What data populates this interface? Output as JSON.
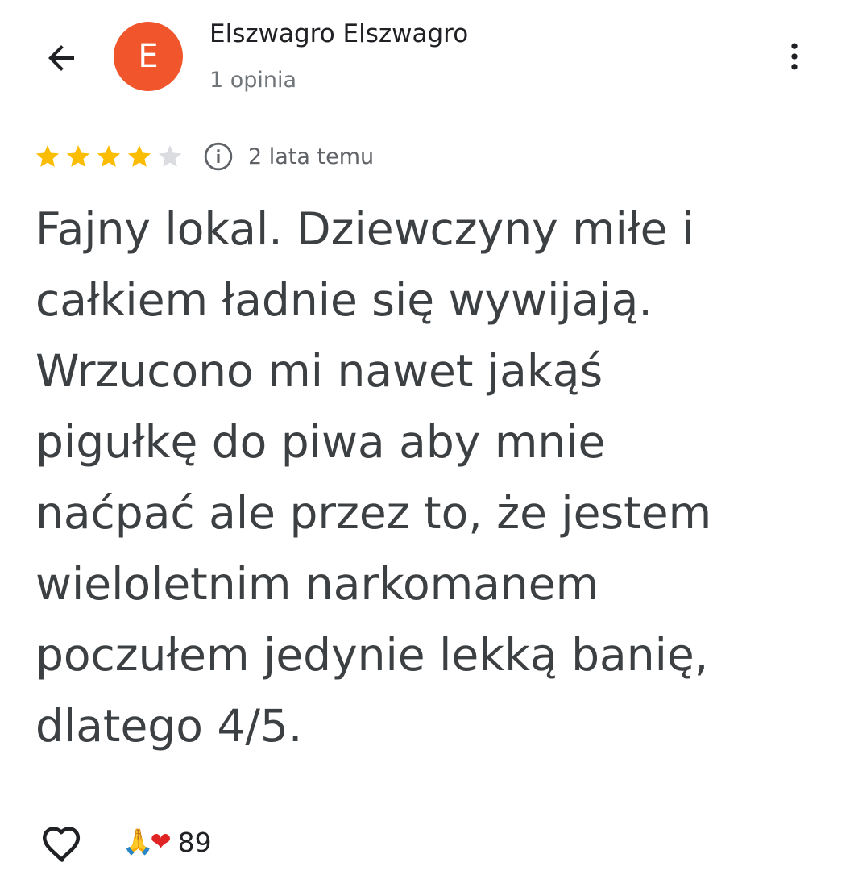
{
  "header": {
    "avatar_letter": "E",
    "avatar_color": "#f0552b",
    "author_name": "Elszwagro Elszwagro",
    "author_meta": "1 opinia",
    "back_icon": "arrow-left-icon",
    "more_icon": "more-vert-icon"
  },
  "review": {
    "rating": 4,
    "max_rating": 5,
    "star_color": "#fbbc04",
    "star_empty_color": "#dadce0",
    "date": "2 lata temu",
    "text_lines": [
      "Fajny lokal. Dziewczyny miłe i",
      "całkiem ładnie się wywijają.",
      "Wrzucono mi nawet jakąś",
      "pigułkę do piwa aby mnie",
      "naćpać ale przez to, że jestem",
      "wieloletnim narkomanem",
      "poczułem jedynie lekką banię,",
      "dlatego 4/5."
    ]
  },
  "footer": {
    "like_icon": "heart-outline-icon",
    "reactions": [
      {
        "emoji": "🙏",
        "name": "folded-hands-emoji"
      },
      {
        "emoji": "❤",
        "name": "red-heart-emoji"
      }
    ],
    "reaction_count": "89"
  }
}
